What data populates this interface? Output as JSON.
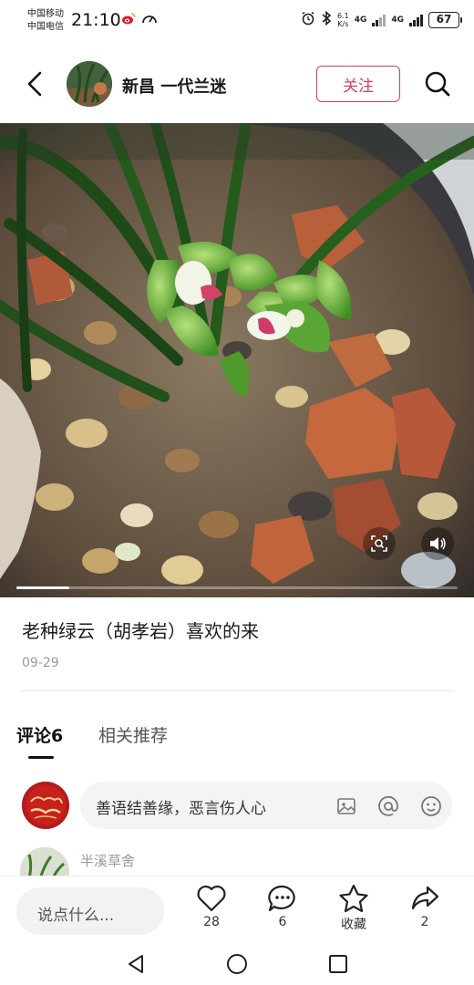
{
  "status_bar": {
    "carrier_1": "中国移动",
    "carrier_2": "中国电信",
    "time": "21:10",
    "speed_value": "6.1",
    "speed_unit": "K/s",
    "network_1": "4G",
    "network_2": "4G",
    "battery": "67"
  },
  "header": {
    "username": "新昌 一代兰迷",
    "follow_label": "关注"
  },
  "media": {
    "progress": 0.12,
    "icons": [
      "image-search-icon",
      "volume-icon"
    ]
  },
  "post": {
    "title": "老种绿云（胡孝岩）喜欢的来",
    "date": "09-29"
  },
  "tabs": {
    "comments": "评论6",
    "related": "相关推荐"
  },
  "comment_input": {
    "placeholder": "善语结善缘，恶言伤人心",
    "icons": [
      "image-icon",
      "mention-icon",
      "emoji-icon"
    ]
  },
  "comments": [
    {
      "author": "半溪草舍"
    }
  ],
  "bottom_bar": {
    "input_placeholder": "说点什么...",
    "likes": "28",
    "comments": "6",
    "favorite": "收藏",
    "shares": "2"
  },
  "colors": {
    "accent": "#d63d5a",
    "text_primary": "#1c1c1c",
    "text_secondary": "#9a9a9a"
  }
}
